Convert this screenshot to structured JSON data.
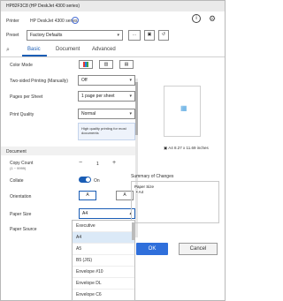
{
  "window": {
    "title": "HP82F3C8 (HP DeskJet 4300 series)"
  },
  "printer": {
    "label": "Printer",
    "value": "HP DeskJet 4300 series"
  },
  "preset": {
    "label": "Preset",
    "value": "Factory Defaults"
  },
  "tabs": [
    {
      "label": "Basic"
    },
    {
      "label": "Document"
    },
    {
      "label": "Advanced"
    }
  ],
  "basic": {
    "color_mode": "Color Mode",
    "two_sided": {
      "label": "Two-sided Printing (Manually)",
      "value": "Off"
    },
    "pages_per_sheet": {
      "label": "Pages per Sheet",
      "value": "1 page per sheet"
    },
    "print_quality": {
      "label": "Print Quality",
      "value": "Normal"
    },
    "quality_note": "High quality printing for most documents"
  },
  "document": {
    "section": "Document",
    "copy_count": {
      "label": "Copy Count",
      "sub": "(1 ~ 9999)",
      "value": "1"
    },
    "collate": {
      "label": "Collate",
      "value": "On"
    },
    "orientation": {
      "label": "Orientation"
    },
    "paper_size": {
      "label": "Paper Size",
      "value": "A4"
    },
    "paper_source": {
      "label": "Paper Source"
    }
  },
  "preview": {
    "size_text": "A4 8.27 x 11.69 inches"
  },
  "summary": {
    "title": "Summary of Changes",
    "line1": "Paper Size",
    "line2": "• A4"
  },
  "dropdown": {
    "items": [
      "Executive",
      "A4",
      "A5",
      "B5 (JIS)",
      "Envelope #10",
      "Envelope DL",
      "Envelope C6"
    ],
    "selected": "A4"
  },
  "buttons": {
    "ok": "OK",
    "cancel": "Cancel"
  }
}
